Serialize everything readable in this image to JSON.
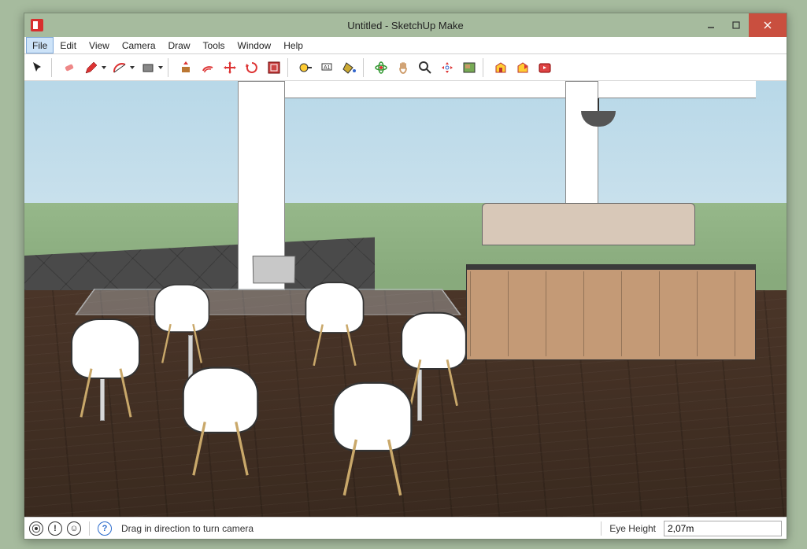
{
  "window": {
    "title": "Untitled - SketchUp Make"
  },
  "menu": {
    "file": "File",
    "edit": "Edit",
    "view": "View",
    "camera": "Camera",
    "draw": "Draw",
    "tools": "Tools",
    "window": "Window",
    "help": "Help"
  },
  "status": {
    "hint": "Drag in direction to turn camera",
    "eye_height_label": "Eye Height",
    "eye_height_value": "2,07m"
  },
  "toolbar_icons": {
    "select": "select-arrow",
    "eraser": "eraser",
    "pencil": "pencil",
    "arc": "arc",
    "rectangle": "rectangle",
    "pushpull": "push-pull",
    "offset": "offset",
    "move": "move",
    "rotate": "rotate",
    "scale": "scale",
    "tape": "tape-measure",
    "text": "text-label",
    "paint": "paint-bucket",
    "orbit": "orbit",
    "pan": "pan",
    "zoom": "zoom",
    "zoom_extents": "zoom-extents",
    "warehouse": "3d-warehouse",
    "layers": "layers",
    "outliner": "outliner",
    "extensions": "extensions"
  }
}
